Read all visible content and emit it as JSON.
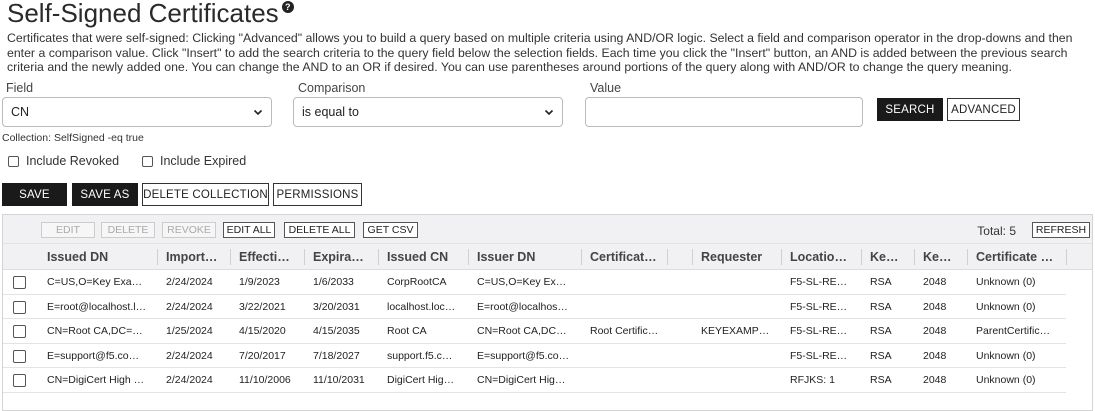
{
  "page": {
    "title": "Self-Signed Certificates",
    "help_icon": "question-circle-icon",
    "description": "Certificates that were self-signed: Clicking \"Advanced\" allows you to build a query based on multiple criteria using AND/OR logic. Select a field and comparison operator in the drop-downs and then enter a comparison value. Click \"Insert\" to add the search criteria to the query field below the selection fields. Each time you click the \"Insert\" button, an AND is added between the previous search criteria and the newly added one. You can change the AND to an OR if desired. You can use parentheses around portions of the query along with AND/OR to change the query meaning."
  },
  "search": {
    "field_label": "Field",
    "field_value": "CN",
    "comparison_label": "Comparison",
    "comparison_value": "is equal to",
    "value_label": "Value",
    "value_value": "",
    "search_button": "SEARCH",
    "advanced_button": "ADVANCED"
  },
  "collection_text": "Collection: SelfSigned -eq true",
  "filters": {
    "include_revoked": "Include Revoked",
    "include_expired": "Include Expired",
    "include_revoked_checked": false,
    "include_expired_checked": false
  },
  "actions": {
    "save": "SAVE",
    "save_as": "SAVE AS",
    "delete_collection": "DELETE COLLECTION",
    "permissions": "PERMISSIONS"
  },
  "grid": {
    "toolbar": {
      "edit": "EDIT",
      "delete": "DELETE",
      "revoke": "REVOKE",
      "edit_all": "EDIT ALL",
      "delete_all": "DELETE ALL",
      "get_csv": "GET CSV",
      "total": "Total: 5",
      "refresh": "REFRESH"
    },
    "columns": [
      "Issued DN",
      "Import…",
      "Effecti…",
      "Expira…",
      "Issued CN",
      "Issuer DN",
      "Certificat…",
      "Requester",
      "Locatio…",
      "Ke…",
      "Ke…",
      "Certificate …"
    ],
    "rows": [
      [
        "C=US,O=Key Exa…",
        "2/24/2024",
        "1/9/2023",
        "1/6/2033",
        "CorpRootCA",
        "C=US,O=Key Ex…",
        "",
        "",
        "F5-SL-RE…",
        "RSA",
        "2048",
        "Unknown (0)"
      ],
      [
        "E=root@localhost.l…",
        "2/24/2024",
        "3/22/2021",
        "3/20/2031",
        "localhost.loc…",
        "E=root@localhos…",
        "",
        "",
        "F5-SL-RE…",
        "RSA",
        "2048",
        "Unknown (0)"
      ],
      [
        "CN=Root CA,DC=…",
        "1/25/2024",
        "4/15/2020",
        "4/15/2035",
        "Root CA",
        "CN=Root CA,DC…",
        "Root Certific…",
        "KEYEXAMP…",
        "F5-SL-RE…",
        "RSA",
        "2048",
        "ParentCertific…"
      ],
      [
        "E=support@f5.co…",
        "2/24/2024",
        "7/20/2017",
        "7/18/2027",
        "support.f5.c…",
        "E=support@f5.co…",
        "",
        "",
        "F5-SL-RE…",
        "RSA",
        "2048",
        "Unknown (0)"
      ],
      [
        "CN=DigiCert High …",
        "2/24/2024",
        "11/10/2006",
        "11/10/2031",
        "DigiCert Hig…",
        "CN=DigiCert Hig…",
        "",
        "",
        "RFJKS: 1",
        "RSA",
        "2048",
        "Unknown (0)"
      ]
    ]
  },
  "colors": {
    "dark_button": "#1a1a1a",
    "grid_header_bg": "#f1f1f3"
  }
}
